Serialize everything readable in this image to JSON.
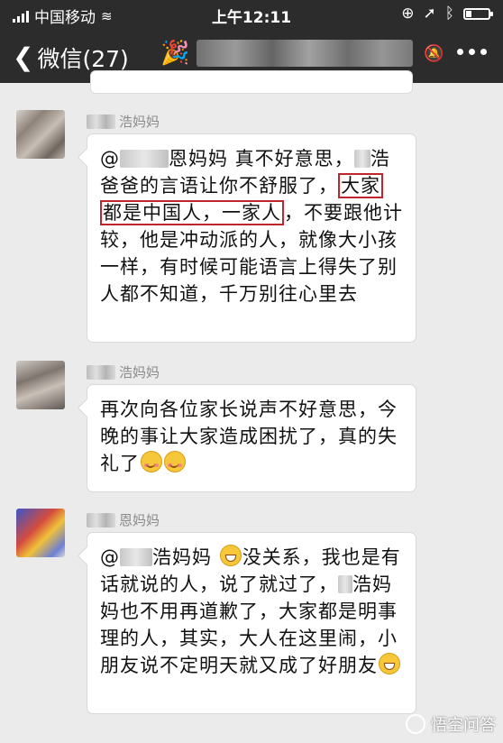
{
  "status": {
    "carrier": "中国移动",
    "time": "上午12:11"
  },
  "navbar": {
    "back_label": "微信(27)",
    "party_icon": "party-popper-icon",
    "more_icon": "more-dots-icon"
  },
  "messages": [
    {
      "sender": "浩妈妈",
      "parts": {
        "p1": "@",
        "p2": "恩妈妈 真不好意思，",
        "p3": "浩爸爸的言语让你不舒服了，",
        "box1": "大家",
        "box2": "都是中国人，一家人",
        "p4": "，不要跟他计较，他是冲动派的人，就像大小孩一样，有时候可能语言上得失了别人都不知道，千万别往心里去"
      }
    },
    {
      "sender": "浩妈妈",
      "text": "再次向各位家长说声不好意思，今晚的事让大家造成困扰了，真的失礼了"
    },
    {
      "sender": "恩妈妈",
      "parts": {
        "p1": "@",
        "p2": "浩妈妈 ",
        "p3": "没关系，我也是有话就说的人，说了就过了，",
        "p4": "浩妈妈也不用再道歉了，大家都是明事理的人，其实，大人在这里闹，小朋友说不定明天就又成了好朋友"
      }
    }
  ],
  "watermark": "悟空问答",
  "colors": {
    "highlight_box": "#c0242c",
    "header_bg": "#2c2c2c",
    "chat_bg": "#ebebeb"
  }
}
